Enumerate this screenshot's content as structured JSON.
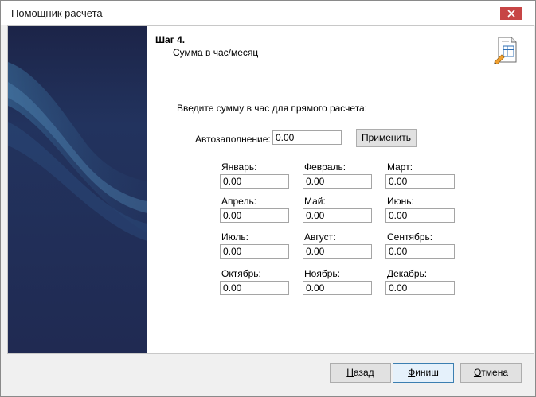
{
  "window": {
    "title": "Помощник расчета"
  },
  "header": {
    "step": "Шаг 4.",
    "subtitle": "Сумма в час/месяц",
    "icon": "document-edit-icon"
  },
  "form": {
    "prompt": "Введите сумму в час для прямого расчета:",
    "autofill_label": "Автозаполнение:",
    "autofill_value": "0.00",
    "apply_label": "Применить",
    "months": [
      {
        "label": "Январь:",
        "value": "0.00"
      },
      {
        "label": "Февраль:",
        "value": "0.00"
      },
      {
        "label": "Март:",
        "value": "0.00"
      },
      {
        "label": "Апрель:",
        "value": "0.00"
      },
      {
        "label": "Май:",
        "value": "0.00"
      },
      {
        "label": "Июнь:",
        "value": "0.00"
      },
      {
        "label": "Июль:",
        "value": "0.00"
      },
      {
        "label": "Август:",
        "value": "0.00"
      },
      {
        "label": "Сентябрь:",
        "value": "0.00"
      },
      {
        "label": "Октябрь:",
        "value": "0.00"
      },
      {
        "label": "Ноябрь:",
        "value": "0.00"
      },
      {
        "label": "Декабрь:",
        "value": "0.00"
      }
    ]
  },
  "footer": {
    "back_accel": "Н",
    "back_rest": "азад",
    "finish_accel": "Ф",
    "finish_rest": "иниш",
    "cancel_accel": "О",
    "cancel_rest": "тмена"
  },
  "colors": {
    "close": "#c74545",
    "sidebar_dark": "#1f2a4f",
    "sidebar_light": "#2d4e78",
    "finish_border": "#3c7fb1"
  }
}
